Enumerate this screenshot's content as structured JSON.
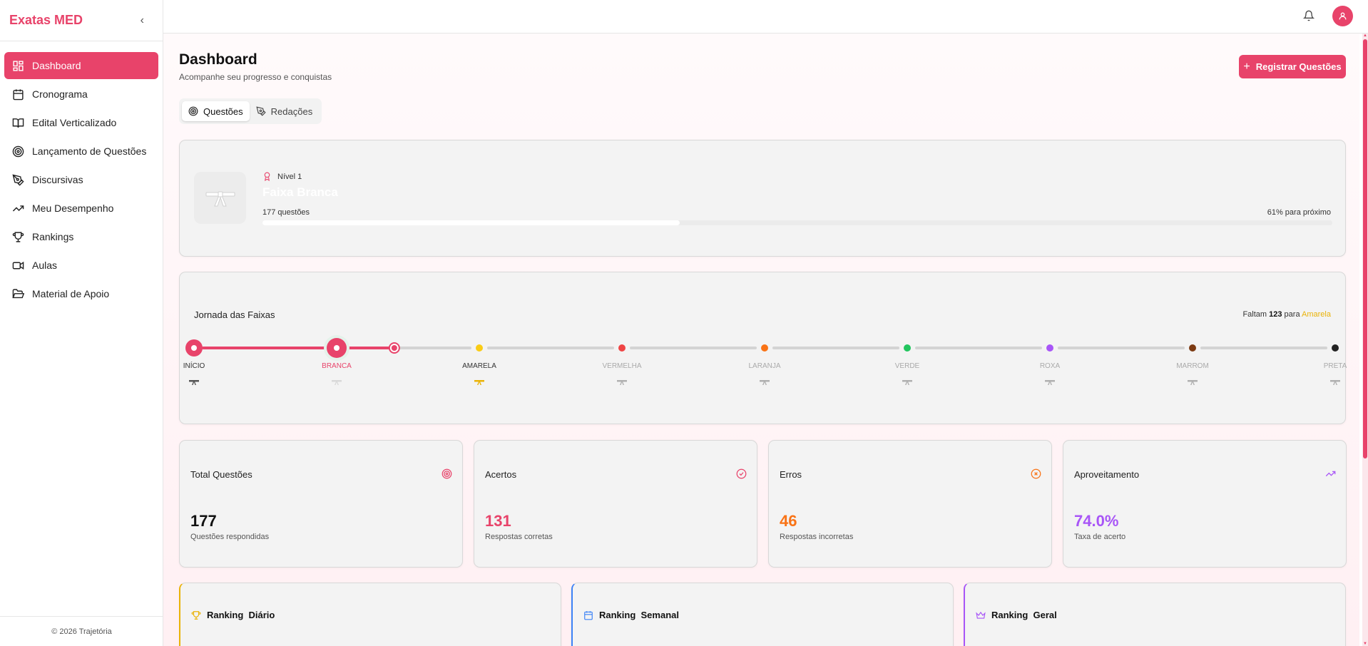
{
  "app": {
    "brand": "Exatas MED",
    "collapse_icon": "chevron-left-icon"
  },
  "sidebar": {
    "items": [
      {
        "label": "Dashboard",
        "icon": "dashboard-grid-icon",
        "active": true
      },
      {
        "label": "Cronograma",
        "icon": "calendar-icon"
      },
      {
        "label": "Edital Verticalizado",
        "icon": "book-open-icon"
      },
      {
        "label": "Lançamento de Questões",
        "icon": "target-icon"
      },
      {
        "label": "Discursivas",
        "icon": "pen-tool-icon"
      },
      {
        "label": "Meu Desempenho",
        "icon": "trending-up-icon"
      },
      {
        "label": "Rankings",
        "icon": "trophy-icon"
      },
      {
        "label": "Aulas",
        "icon": "video-icon"
      },
      {
        "label": "Material de Apoio",
        "icon": "folder-open-icon"
      }
    ],
    "footer": "© 2026 Trajetória"
  },
  "header": {
    "title": "Dashboard",
    "subtitle": "Acompanhe seu progresso e conquistas",
    "primary_button": "Registrar Questões"
  },
  "tabs": [
    {
      "label": "Questões",
      "active": true,
      "icon": "target-icon"
    },
    {
      "label": "Redações",
      "active": false,
      "icon": "pen-tool-icon"
    }
  ],
  "level": {
    "tag": "Nível 1",
    "belt_name": "Faixa Branca",
    "questions": "177 questões",
    "next": "61% para próximo",
    "progress": 0.39
  },
  "journey": {
    "title": "Jornada das Faixas",
    "remaining_prefix": "Faltam",
    "remaining_count": "123",
    "remaining_mid": "para",
    "remaining_target": "Amarela",
    "current_index": 1,
    "progress_to_next": 0.39,
    "belts": [
      {
        "label": "INÍCIO",
        "color": "#e8436a",
        "belt_color": "#555555"
      },
      {
        "label": "BRANCA",
        "color": "#e8436a",
        "belt_color": "#d9d9d9"
      },
      {
        "label": "AMARELA",
        "color": "#facc15",
        "belt_color": "#eab308"
      },
      {
        "label": "VERMELHA",
        "color": "#ef4444",
        "belt_color": "#b0b0b0"
      },
      {
        "label": "LARANJA",
        "color": "#f97316",
        "belt_color": "#b0b0b0"
      },
      {
        "label": "VERDE",
        "color": "#22c55e",
        "belt_color": "#b0b0b0"
      },
      {
        "label": "ROXA",
        "color": "#a855f7",
        "belt_color": "#b0b0b0"
      },
      {
        "label": "MARROM",
        "color": "#7c3a12",
        "belt_color": "#b0b0b0"
      },
      {
        "label": "PRETA",
        "color": "#222222",
        "belt_color": "#b0b0b0"
      }
    ]
  },
  "stats": [
    {
      "label": "Total Questões",
      "value": "177",
      "desc": "Questões respondidas",
      "color": "#111111",
      "icon": "target-icon",
      "icon_color": "#e8436a"
    },
    {
      "label": "Acertos",
      "value": "131",
      "desc": "Respostas corretas",
      "color": "#e8436a",
      "icon": "check-circle-icon",
      "icon_color": "#e8436a"
    },
    {
      "label": "Erros",
      "value": "46",
      "desc": "Respostas incorretas",
      "color": "#f97316",
      "icon": "x-circle-icon",
      "icon_color": "#f97316"
    },
    {
      "label": "Aproveitamento",
      "value": "74.0%",
      "desc": "Taxa de acerto",
      "color": "#a855f7",
      "icon": "trending-up-icon",
      "icon_color": "#a855f7"
    }
  ],
  "rankings": [
    {
      "title": "Ranking  Diário",
      "icon": "trophy-icon",
      "accent": "#eab308"
    },
    {
      "title": "Ranking  Semanal",
      "icon": "calendar-icon",
      "accent": "#3b82f6"
    },
    {
      "title": "Ranking  Geral",
      "icon": "crown-icon",
      "accent": "#a855f7"
    }
  ],
  "colors": {
    "accent": "#e8436a",
    "muted_track": "#d4d4d4"
  }
}
